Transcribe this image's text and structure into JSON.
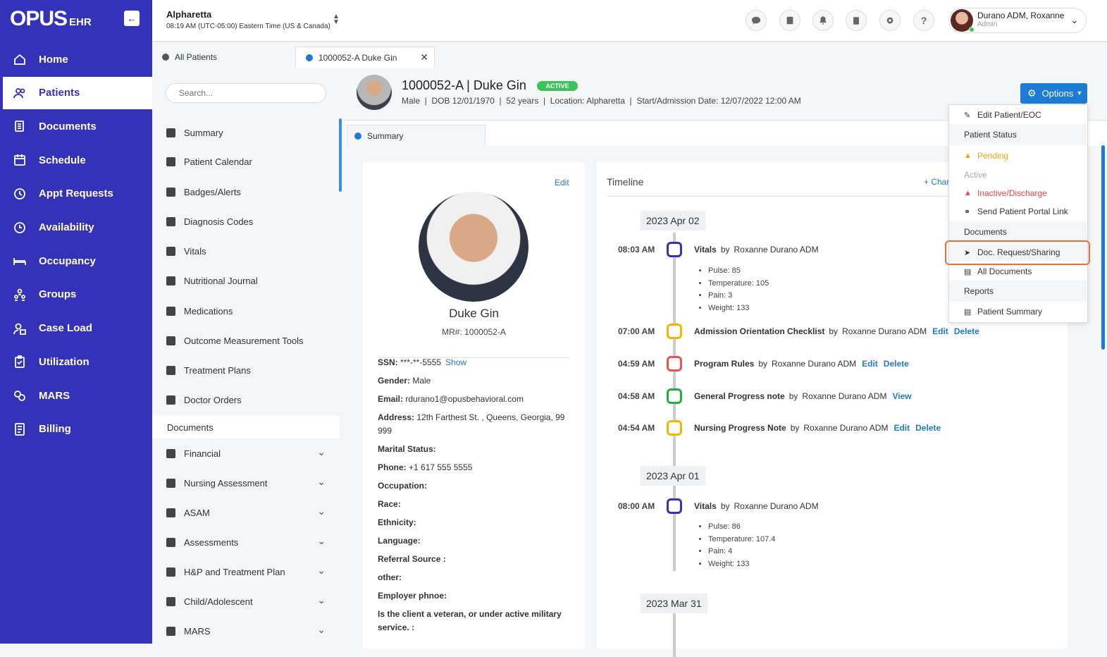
{
  "app": {
    "logo_main": "OPUS",
    "logo_sub": "EHR"
  },
  "nav": [
    {
      "label": "Home",
      "icon": "home-icon"
    },
    {
      "label": "Patients",
      "icon": "users-icon",
      "active": true
    },
    {
      "label": "Documents",
      "icon": "documents-icon"
    },
    {
      "label": "Schedule",
      "icon": "calendar-icon"
    },
    {
      "label": "Appt Requests",
      "icon": "clock-icon"
    },
    {
      "label": "Availability",
      "icon": "availability-icon"
    },
    {
      "label": "Occupancy",
      "icon": "bed-icon"
    },
    {
      "label": "Groups",
      "icon": "groups-icon"
    },
    {
      "label": "Case Load",
      "icon": "caseload-icon"
    },
    {
      "label": "Utilization",
      "icon": "clipboard-check-icon"
    },
    {
      "label": "MARS",
      "icon": "pills-icon"
    },
    {
      "label": "Billing",
      "icon": "billing-icon"
    }
  ],
  "topbar": {
    "location": "Alpharetta",
    "time": "08:19 AM (UTC-05:00) Eastern Time (US & Canada)",
    "user_name": "Durano ADM, Roxanne",
    "user_role": "Admin"
  },
  "tabs": [
    {
      "label": "All Patients"
    },
    {
      "label": "1000052-A Duke Gin"
    }
  ],
  "side": {
    "search_placeholder": "Search...",
    "items": [
      "Summary",
      "Patient Calendar",
      "Badges/Alerts",
      "Diagnosis Codes",
      "Vitals",
      "Nutritional Journal",
      "Medications",
      "Outcome Measurement Tools",
      "Treatment Plans",
      "Doctor Orders"
    ],
    "docs_header": "Documents",
    "folders": [
      "Financial",
      "Nursing Assessment",
      "ASAM",
      "Assessments",
      "H&P and Treatment Plan",
      "Child/Adolescent",
      "MARS"
    ]
  },
  "patient": {
    "id": "1000052-A",
    "sep": "|",
    "name": "Duke Gin",
    "status": "ACTIVE",
    "info": "Male  |  DOB 12/01/1970  |  52 years  |  Location: Alpharetta  |  Start/Admission Date: 12/07/2022 12:00 AM",
    "mr": "MR#: 1000052-A",
    "edit": "Edit"
  },
  "options_label": "Options",
  "summary_tab": "Summary",
  "profile_fields": [
    {
      "label": "SSN:",
      "value": " ***-**-5555",
      "link": "Show"
    },
    {
      "label": "Gender:",
      "value": " Male"
    },
    {
      "label": "Email:",
      "value": " rdurano1@opusbehavioral.com"
    },
    {
      "label": "Address:",
      "value": " 12th Farthest St. , Queens, Georgia, 99 999"
    },
    {
      "label": "Marital Status:",
      "value": ""
    },
    {
      "label": "Phone:",
      "value": " +1 617 555 5555"
    },
    {
      "label": "Occupation:",
      "value": ""
    },
    {
      "label": "Race:",
      "value": ""
    },
    {
      "label": "Ethnicity:",
      "value": ""
    },
    {
      "label": "Language:",
      "value": ""
    },
    {
      "label": "Referral Source :",
      "value": ""
    },
    {
      "label": "other:",
      "value": ""
    },
    {
      "label": "Employer phnoe:",
      "value": ""
    },
    {
      "label": "Is the client a veteran, or under active military service. :",
      "value": ""
    }
  ],
  "timeline": {
    "title": "Timeline",
    "change": "+ Char",
    "dates": [
      "2023 Apr 02",
      "2023 Apr 01",
      "2023 Mar 31"
    ],
    "by": "by",
    "events": [
      {
        "time": "08:03 AM",
        "title": "Vitals",
        "author": "Roxanne Durano ADM",
        "color": "#3432b8",
        "links": [],
        "details": [
          "Pulse: 85",
          "Temperature: 105",
          "Pain: 3",
          "Weight: 133"
        ]
      },
      {
        "time": "07:00 AM",
        "title": "Admission Orientation Checklist",
        "author": "Roxanne Durano ADM",
        "color": "#f5b400",
        "links": [
          "Edit",
          "Delete"
        ]
      },
      {
        "time": "04:59 AM",
        "title": "Program Rules",
        "author": "Roxanne Durano ADM",
        "color": "#ef5350",
        "links": [
          "Edit",
          "Delete"
        ]
      },
      {
        "time": "04:58 AM",
        "title": "General Progress note",
        "author": "Roxanne Durano ADM",
        "color": "#1fb141",
        "links": [
          "View"
        ]
      },
      {
        "time": "04:54 AM",
        "title": "Nursing Progress Note",
        "author": "Roxanne Durano ADM",
        "color": "#f5b400",
        "links": [
          "Edit",
          "Delete"
        ]
      },
      {
        "time": "08:00 AM",
        "title": "Vitals",
        "author": "Roxanne Durano ADM",
        "color": "#3432b8",
        "links": [],
        "details": [
          "Pulse: 86",
          "Temperature: 107.4",
          "Pain: 4",
          "Weight: 133"
        ]
      }
    ]
  },
  "dropdown": [
    {
      "label": "Edit Patient/EOC",
      "type": "item",
      "icon": "edit-icon"
    },
    {
      "label": "Patient Status",
      "type": "head"
    },
    {
      "label": "Pending",
      "type": "item",
      "icon": "person-icon",
      "color": "#f59e0b"
    },
    {
      "label": "Active",
      "type": "item",
      "color": "#aaaaaa"
    },
    {
      "label": "Inactive/Discharge",
      "type": "item",
      "icon": "person-icon",
      "color": "#ef4444"
    },
    {
      "label": "Send Patient Portal Link",
      "type": "item",
      "icon": "link-icon"
    },
    {
      "label": "Documents",
      "type": "head"
    },
    {
      "label": "Doc. Request/Sharing",
      "type": "item",
      "icon": "send-icon",
      "highlight": true
    },
    {
      "label": "All Documents",
      "type": "item",
      "icon": "file-icon"
    },
    {
      "label": "Reports",
      "type": "head"
    },
    {
      "label": "Patient Summary",
      "type": "item",
      "icon": "file-icon"
    }
  ],
  "colors": {
    "nav": "#3432b8",
    "accent": "#1c7bd6",
    "active_badge": "#3bc45a",
    "highlight": "#e8703e"
  }
}
